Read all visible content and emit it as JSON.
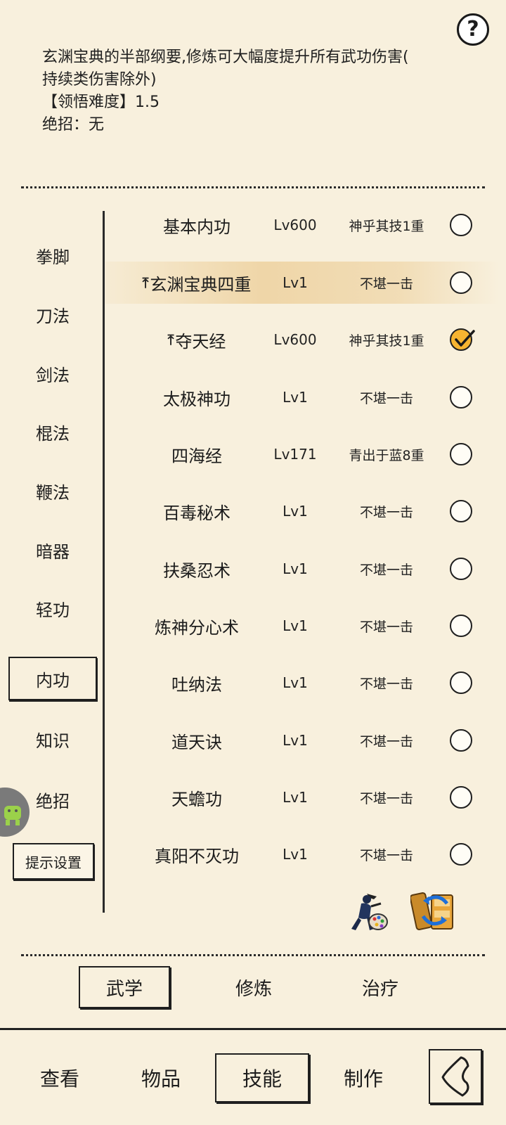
{
  "help": {
    "icon": "question-icon",
    "label": "?"
  },
  "description": {
    "line1": "玄渊宝典的半部纲要,修炼可大幅度提升所有武功伤害(",
    "line2": "持续类伤害除外)",
    "difficulty": "【领悟难度】1.5",
    "ultimate": "绝招：无"
  },
  "categories": [
    {
      "label": "拳脚",
      "selected": false
    },
    {
      "label": "刀法",
      "selected": false
    },
    {
      "label": "剑法",
      "selected": false
    },
    {
      "label": "棍法",
      "selected": false
    },
    {
      "label": "鞭法",
      "selected": false
    },
    {
      "label": "暗器",
      "selected": false
    },
    {
      "label": "轻功",
      "selected": false
    },
    {
      "label": "内功",
      "selected": true
    },
    {
      "label": "知识",
      "selected": false
    },
    {
      "label": "绝招",
      "selected": false
    }
  ],
  "tip_settings": "提示设置",
  "skills": [
    {
      "name": "基本内功",
      "level": "Lv600",
      "rank": "神乎其技1重",
      "checked": false,
      "upgrade": false,
      "highlight": false
    },
    {
      "name": "玄渊宝典四重",
      "level": "Lv1",
      "rank": "不堪一击",
      "checked": false,
      "upgrade": true,
      "highlight": true
    },
    {
      "name": "夺天经",
      "level": "Lv600",
      "rank": "神乎其技1重",
      "checked": true,
      "upgrade": true,
      "highlight": false
    },
    {
      "name": "太极神功",
      "level": "Lv1",
      "rank": "不堪一击",
      "checked": false,
      "upgrade": false,
      "highlight": false
    },
    {
      "name": "四海经",
      "level": "Lv171",
      "rank": "青出于蓝8重",
      "checked": false,
      "upgrade": false,
      "highlight": false
    },
    {
      "name": "百毒秘术",
      "level": "Lv1",
      "rank": "不堪一击",
      "checked": false,
      "upgrade": false,
      "highlight": false
    },
    {
      "name": "扶桑忍术",
      "level": "Lv1",
      "rank": "不堪一击",
      "checked": false,
      "upgrade": false,
      "highlight": false
    },
    {
      "name": "炼神分心术",
      "level": "Lv1",
      "rank": "不堪一击",
      "checked": false,
      "upgrade": false,
      "highlight": false
    },
    {
      "name": "吐纳法",
      "level": "Lv1",
      "rank": "不堪一击",
      "checked": false,
      "upgrade": false,
      "highlight": false
    },
    {
      "name": "道天诀",
      "level": "Lv1",
      "rank": "不堪一击",
      "checked": false,
      "upgrade": false,
      "highlight": false
    },
    {
      "name": "天蟾功",
      "level": "Lv1",
      "rank": "不堪一击",
      "checked": false,
      "upgrade": false,
      "highlight": false
    },
    {
      "name": "真阳不灭功",
      "level": "Lv1",
      "rank": "不堪一击",
      "checked": false,
      "upgrade": false,
      "highlight": false
    }
  ],
  "action_icons": [
    "paint-palette-icon",
    "swap-scroll-icon"
  ],
  "subtabs": [
    {
      "label": "武学",
      "selected": true
    },
    {
      "label": "修炼",
      "selected": false
    },
    {
      "label": "治疗",
      "selected": false
    }
  ],
  "bottom_nav": [
    {
      "label": "查看",
      "selected": false
    },
    {
      "label": "物品",
      "selected": false
    },
    {
      "label": "技能",
      "selected": true
    },
    {
      "label": "制作",
      "selected": false
    }
  ],
  "back_icon": "back-chevron-icon",
  "floating_icon": "android-bug-icon"
}
